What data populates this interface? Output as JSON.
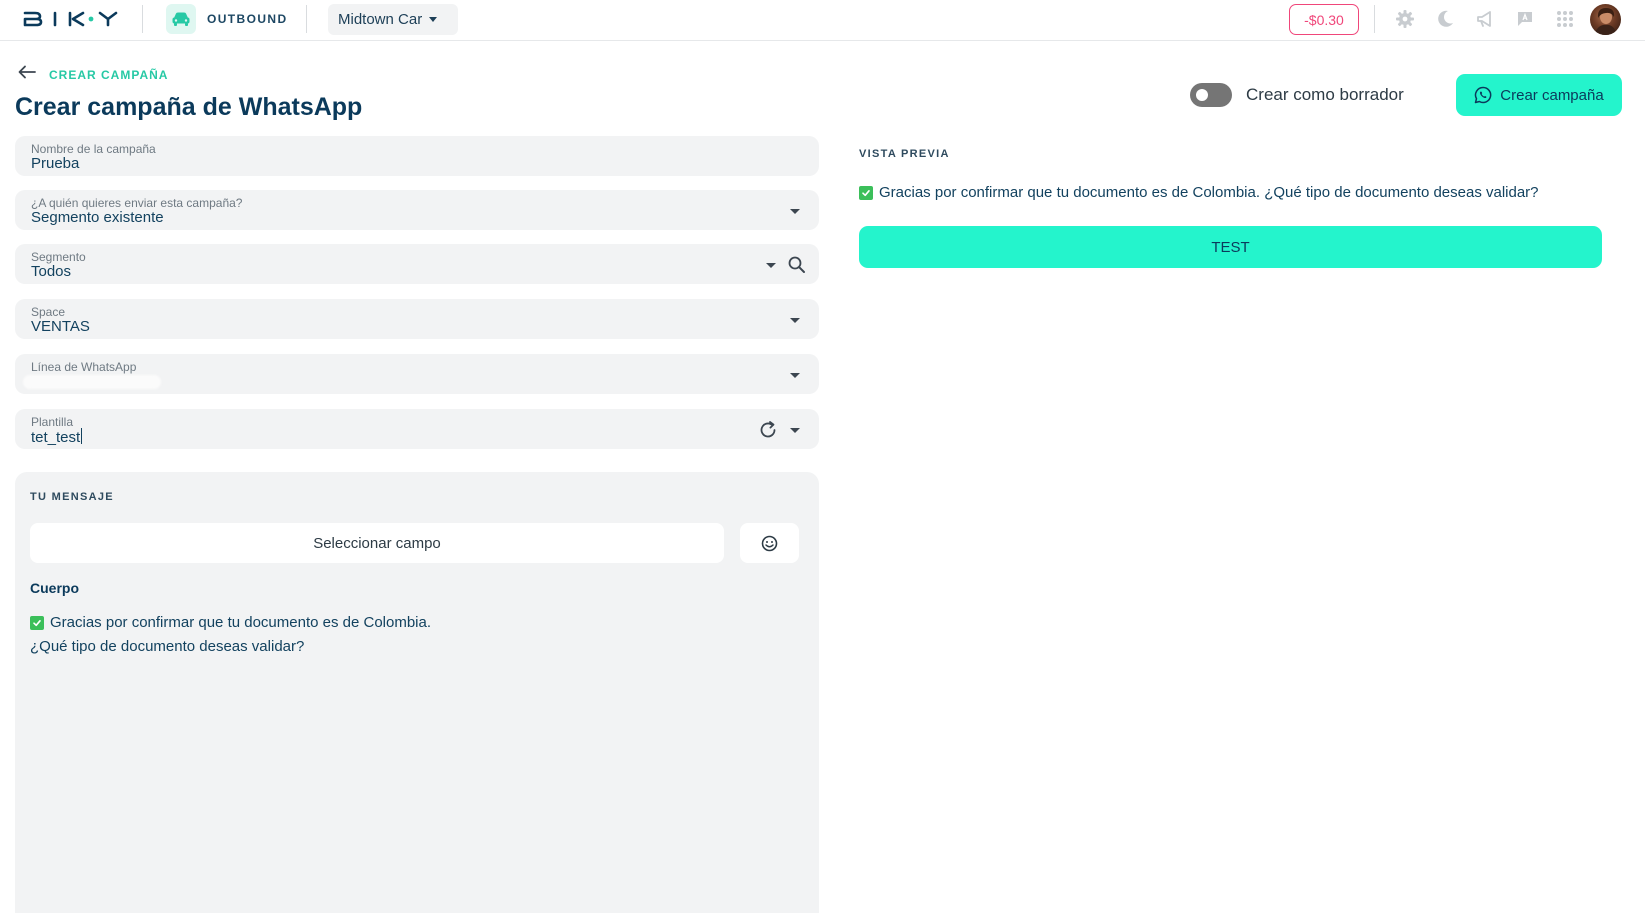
{
  "topbar": {
    "logo_text": "BIKY",
    "app_label": "OUTBOUND",
    "account": "Midtown Car",
    "balance": "-$0.30",
    "icons": [
      "car-icon",
      "settings-icon",
      "moon-icon",
      "megaphone-icon",
      "chat-icon",
      "apps-grid-icon",
      "avatar"
    ]
  },
  "header": {
    "back_label": "CREAR CAMPAÑA",
    "title": "Crear campaña de WhatsApp",
    "draft_label": "Crear como borrador",
    "draft_on": false,
    "create_label": "Crear campaña"
  },
  "form": {
    "name": {
      "label": "Nombre de la campaña",
      "value": "Prueba"
    },
    "audience": {
      "label": "¿A quién quieres enviar esta campaña?",
      "value": "Segmento existente"
    },
    "segment": {
      "label": "Segmento",
      "value": "Todos"
    },
    "space": {
      "label": "Space",
      "value": "VENTAS"
    },
    "line": {
      "label": "Línea de WhatsApp",
      "value": ""
    },
    "template": {
      "label": "Plantilla",
      "value": "tet_test"
    }
  },
  "message": {
    "section_label": "TU MENSAJE",
    "select_field_label": "Seleccionar campo",
    "body_title": "Cuerpo",
    "body_line1": "Gracias por confirmar que tu documento es de Colombia.",
    "body_line2": "¿Qué tipo de documento deseas validar?"
  },
  "preview": {
    "label": "VISTA PREVIA",
    "text": "Gracias por confirmar que tu documento es de Colombia. ¿Qué tipo de documento deseas validar?",
    "button": "TEST"
  },
  "colors": {
    "accent": "#24f4cc",
    "brand_text": "#0b3a5b",
    "balance": "#f0467a",
    "check": "#3bbf5a",
    "field_bg": "#f2f3f4"
  }
}
